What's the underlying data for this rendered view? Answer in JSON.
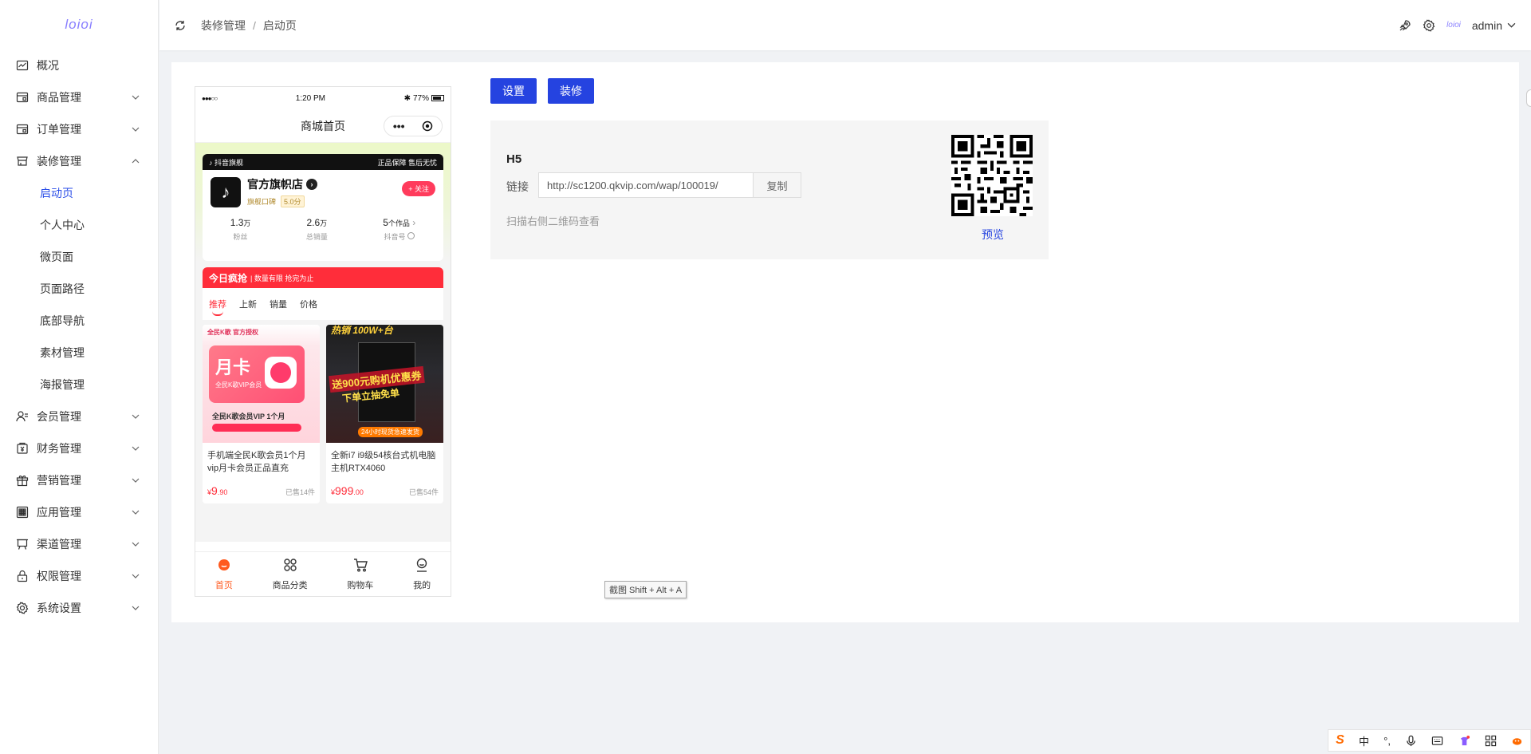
{
  "app": {
    "logo": "loioi"
  },
  "sidebar": {
    "items": [
      {
        "label": "概况",
        "icon": "chart-line-icon",
        "expandable": false
      },
      {
        "label": "商品管理",
        "icon": "goods-icon",
        "expandable": true
      },
      {
        "label": "订单管理",
        "icon": "order-icon",
        "expandable": true
      },
      {
        "label": "装修管理",
        "icon": "store-icon",
        "expandable": true,
        "expanded": true
      }
    ],
    "submenu": [
      {
        "label": "启动页",
        "active": true
      },
      {
        "label": "个人中心"
      },
      {
        "label": "微页面"
      },
      {
        "label": "页面路径"
      },
      {
        "label": "底部导航"
      },
      {
        "label": "素材管理"
      },
      {
        "label": "海报管理"
      }
    ],
    "items_after": [
      {
        "label": "会员管理",
        "icon": "member-icon"
      },
      {
        "label": "财务管理",
        "icon": "finance-icon"
      },
      {
        "label": "营销管理",
        "icon": "gift-icon"
      },
      {
        "label": "应用管理",
        "icon": "apps-icon"
      },
      {
        "label": "渠道管理",
        "icon": "channel-icon"
      },
      {
        "label": "权限管理",
        "icon": "lock-icon"
      },
      {
        "label": "系统设置",
        "icon": "gear-icon"
      }
    ]
  },
  "header": {
    "breadcrumb": [
      "装修管理",
      "启动页"
    ],
    "breadcrumb_sep": "/",
    "mini_logo": "loioi",
    "user": "admin"
  },
  "toolbar": {
    "settings_label": "设置",
    "decorate_label": "装修"
  },
  "phone": {
    "status": {
      "signal": "●●●○○",
      "time": "1:20 PM",
      "battery": "77%"
    },
    "nav_title": "商城首页",
    "capsule_dots": "•••",
    "shop": {
      "badge": "抖音旗舰",
      "guarantee": "正品保障 售后无忧",
      "name": "官方旗帜店",
      "tagline": "旗舰口碑",
      "score": "5.0分",
      "follow": "+ 关注",
      "stats": [
        {
          "num": "1.3",
          "unit": "万",
          "label": "粉丝"
        },
        {
          "num": "2.6",
          "unit": "万",
          "label": "总销量"
        },
        {
          "num": "5",
          "unit": "个作品",
          "label": "抖音号"
        }
      ]
    },
    "flash": {
      "title": "今日疯抢",
      "sub": "| 数量有限 抢完为止"
    },
    "tabs": [
      "推荐",
      "上新",
      "销量",
      "价格"
    ],
    "products": [
      {
        "title": "手机端全民K歌会员1个月vip月卡会员正品直充",
        "price_int": "9",
        "price_dec": ".90",
        "sold": "已售14件",
        "img_top": "全民K歌 官方授权",
        "img_main": "月卡",
        "img_sub": "全民K歌VIP会员",
        "img_foot": "全民K歌会员VIP 1个月"
      },
      {
        "title": "全新i7 i9级54核台式机电脑主机RTX4060",
        "price_int": "999",
        "price_dec": ".00",
        "sold": "已售54件",
        "img_top": "热销 100W+台",
        "img_main": "送900元购机优惠券",
        "img_sub": "下单立抽免单",
        "img_foot": "24小时现货急速发货"
      }
    ],
    "tabbar": [
      {
        "label": "首页",
        "icon": "home-icon",
        "active": true
      },
      {
        "label": "商品分类",
        "icon": "category-icon"
      },
      {
        "label": "购物车",
        "icon": "cart-icon"
      },
      {
        "label": "我的",
        "icon": "user-icon"
      }
    ],
    "currency": "¥"
  },
  "h5": {
    "title": "H5",
    "link_label": "链接",
    "url": "http://sc1200.qkvip.com/wap/100019/",
    "copy_label": "复制",
    "hint": "扫描右侧二维码查看",
    "preview_label": "预览"
  },
  "tooltip": "截图 Shift + Alt + A",
  "ime": {
    "mode": "中"
  }
}
